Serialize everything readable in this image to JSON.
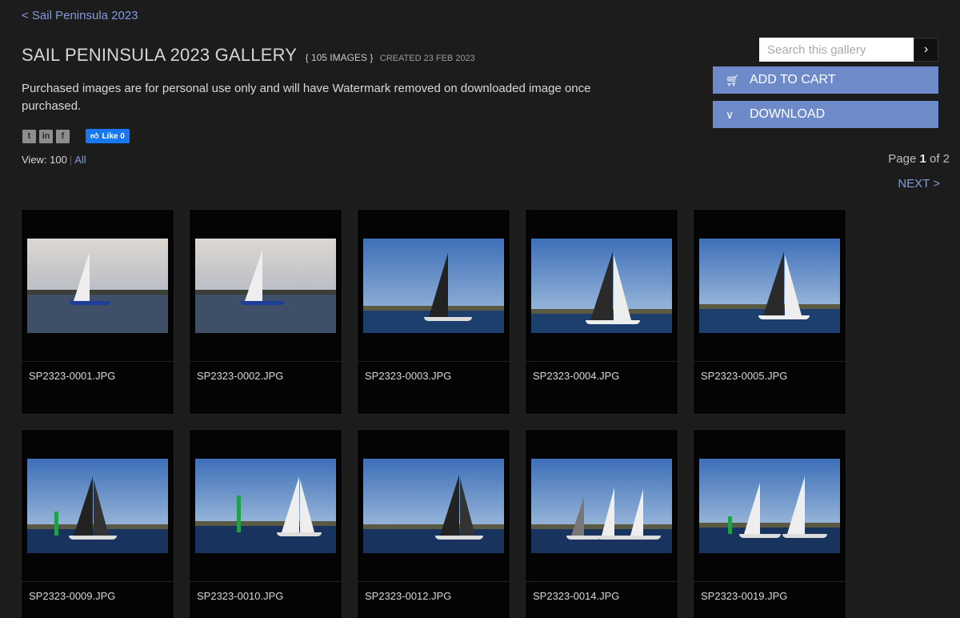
{
  "header": {
    "back_link": "< Sail Peninsula 2023",
    "title": "SAIL PENINSULA 2023 GALLERY",
    "count": "{ 105 IMAGES }",
    "created": "CREATED 23 FEB 2023",
    "description": "Purchased images are for personal use only and will have Watermark removed on downloaded image once purchased."
  },
  "social": {
    "twitter": "t",
    "linkedin": "in",
    "facebook": "f",
    "like_label": "Like 0"
  },
  "view": {
    "label": "View: 100",
    "all_label": "All"
  },
  "search": {
    "placeholder": "Search this gallery",
    "button_icon": "chevron-right-icon"
  },
  "actions": {
    "add_to_cart": "ADD TO CART",
    "download": "DOWNLOAD"
  },
  "pagination": {
    "prefix": "Page ",
    "current": "1",
    "suffix": " of 2",
    "next": "NEXT >"
  },
  "colors": {
    "accent": "#6f8ac8",
    "link": "#7f9be0",
    "background": "#1c1c1c"
  },
  "images": [
    {
      "filename": "SP2323-0001.JPG"
    },
    {
      "filename": "SP2323-0002.JPG"
    },
    {
      "filename": "SP2323-0003.JPG"
    },
    {
      "filename": "SP2323-0004.JPG"
    },
    {
      "filename": "SP2323-0005.JPG"
    },
    {
      "filename": "SP2323-0009.JPG"
    },
    {
      "filename": "SP2323-0010.JPG"
    },
    {
      "filename": "SP2323-0012.JPG"
    },
    {
      "filename": "SP2323-0014.JPG"
    },
    {
      "filename": "SP2323-0019.JPG"
    }
  ]
}
